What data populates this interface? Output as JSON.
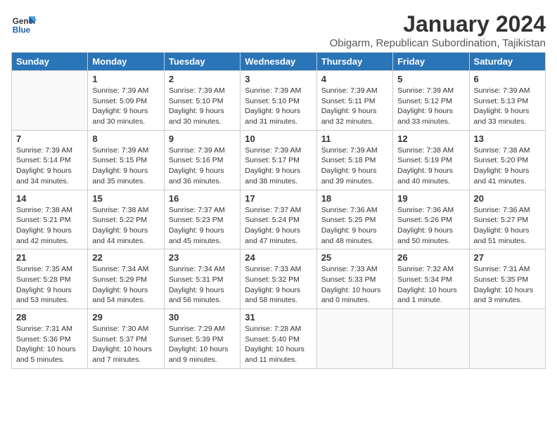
{
  "logo": {
    "line1": "General",
    "line2": "Blue"
  },
  "title": "January 2024",
  "location": "Obigarm, Republican Subordination, Tajikistan",
  "days_of_week": [
    "Sunday",
    "Monday",
    "Tuesday",
    "Wednesday",
    "Thursday",
    "Friday",
    "Saturday"
  ],
  "weeks": [
    [
      {
        "day": "",
        "empty": true
      },
      {
        "day": "1",
        "sunrise": "7:39 AM",
        "sunset": "5:09 PM",
        "daylight": "9 hours and 30 minutes."
      },
      {
        "day": "2",
        "sunrise": "7:39 AM",
        "sunset": "5:10 PM",
        "daylight": "9 hours and 30 minutes."
      },
      {
        "day": "3",
        "sunrise": "7:39 AM",
        "sunset": "5:10 PM",
        "daylight": "9 hours and 31 minutes."
      },
      {
        "day": "4",
        "sunrise": "7:39 AM",
        "sunset": "5:11 PM",
        "daylight": "9 hours and 32 minutes."
      },
      {
        "day": "5",
        "sunrise": "7:39 AM",
        "sunset": "5:12 PM",
        "daylight": "9 hours and 33 minutes."
      },
      {
        "day": "6",
        "sunrise": "7:39 AM",
        "sunset": "5:13 PM",
        "daylight": "9 hours and 33 minutes."
      }
    ],
    [
      {
        "day": "7",
        "sunrise": "7:39 AM",
        "sunset": "5:14 PM",
        "daylight": "9 hours and 34 minutes."
      },
      {
        "day": "8",
        "sunrise": "7:39 AM",
        "sunset": "5:15 PM",
        "daylight": "9 hours and 35 minutes."
      },
      {
        "day": "9",
        "sunrise": "7:39 AM",
        "sunset": "5:16 PM",
        "daylight": "9 hours and 36 minutes."
      },
      {
        "day": "10",
        "sunrise": "7:39 AM",
        "sunset": "5:17 PM",
        "daylight": "9 hours and 38 minutes."
      },
      {
        "day": "11",
        "sunrise": "7:39 AM",
        "sunset": "5:18 PM",
        "daylight": "9 hours and 39 minutes."
      },
      {
        "day": "12",
        "sunrise": "7:38 AM",
        "sunset": "5:19 PM",
        "daylight": "9 hours and 40 minutes."
      },
      {
        "day": "13",
        "sunrise": "7:38 AM",
        "sunset": "5:20 PM",
        "daylight": "9 hours and 41 minutes."
      }
    ],
    [
      {
        "day": "14",
        "sunrise": "7:38 AM",
        "sunset": "5:21 PM",
        "daylight": "9 hours and 42 minutes."
      },
      {
        "day": "15",
        "sunrise": "7:38 AM",
        "sunset": "5:22 PM",
        "daylight": "9 hours and 44 minutes."
      },
      {
        "day": "16",
        "sunrise": "7:37 AM",
        "sunset": "5:23 PM",
        "daylight": "9 hours and 45 minutes."
      },
      {
        "day": "17",
        "sunrise": "7:37 AM",
        "sunset": "5:24 PM",
        "daylight": "9 hours and 47 minutes."
      },
      {
        "day": "18",
        "sunrise": "7:36 AM",
        "sunset": "5:25 PM",
        "daylight": "9 hours and 48 minutes."
      },
      {
        "day": "19",
        "sunrise": "7:36 AM",
        "sunset": "5:26 PM",
        "daylight": "9 hours and 50 minutes."
      },
      {
        "day": "20",
        "sunrise": "7:36 AM",
        "sunset": "5:27 PM",
        "daylight": "9 hours and 51 minutes."
      }
    ],
    [
      {
        "day": "21",
        "sunrise": "7:35 AM",
        "sunset": "5:28 PM",
        "daylight": "9 hours and 53 minutes."
      },
      {
        "day": "22",
        "sunrise": "7:34 AM",
        "sunset": "5:29 PM",
        "daylight": "9 hours and 54 minutes."
      },
      {
        "day": "23",
        "sunrise": "7:34 AM",
        "sunset": "5:31 PM",
        "daylight": "9 hours and 56 minutes."
      },
      {
        "day": "24",
        "sunrise": "7:33 AM",
        "sunset": "5:32 PM",
        "daylight": "9 hours and 58 minutes."
      },
      {
        "day": "25",
        "sunrise": "7:33 AM",
        "sunset": "5:33 PM",
        "daylight": "10 hours and 0 minutes."
      },
      {
        "day": "26",
        "sunrise": "7:32 AM",
        "sunset": "5:34 PM",
        "daylight": "10 hours and 1 minute."
      },
      {
        "day": "27",
        "sunrise": "7:31 AM",
        "sunset": "5:35 PM",
        "daylight": "10 hours and 3 minutes."
      }
    ],
    [
      {
        "day": "28",
        "sunrise": "7:31 AM",
        "sunset": "5:36 PM",
        "daylight": "10 hours and 5 minutes."
      },
      {
        "day": "29",
        "sunrise": "7:30 AM",
        "sunset": "5:37 PM",
        "daylight": "10 hours and 7 minutes."
      },
      {
        "day": "30",
        "sunrise": "7:29 AM",
        "sunset": "5:39 PM",
        "daylight": "10 hours and 9 minutes."
      },
      {
        "day": "31",
        "sunrise": "7:28 AM",
        "sunset": "5:40 PM",
        "daylight": "10 hours and 11 minutes."
      },
      {
        "day": "",
        "empty": true
      },
      {
        "day": "",
        "empty": true
      },
      {
        "day": "",
        "empty": true
      }
    ]
  ]
}
